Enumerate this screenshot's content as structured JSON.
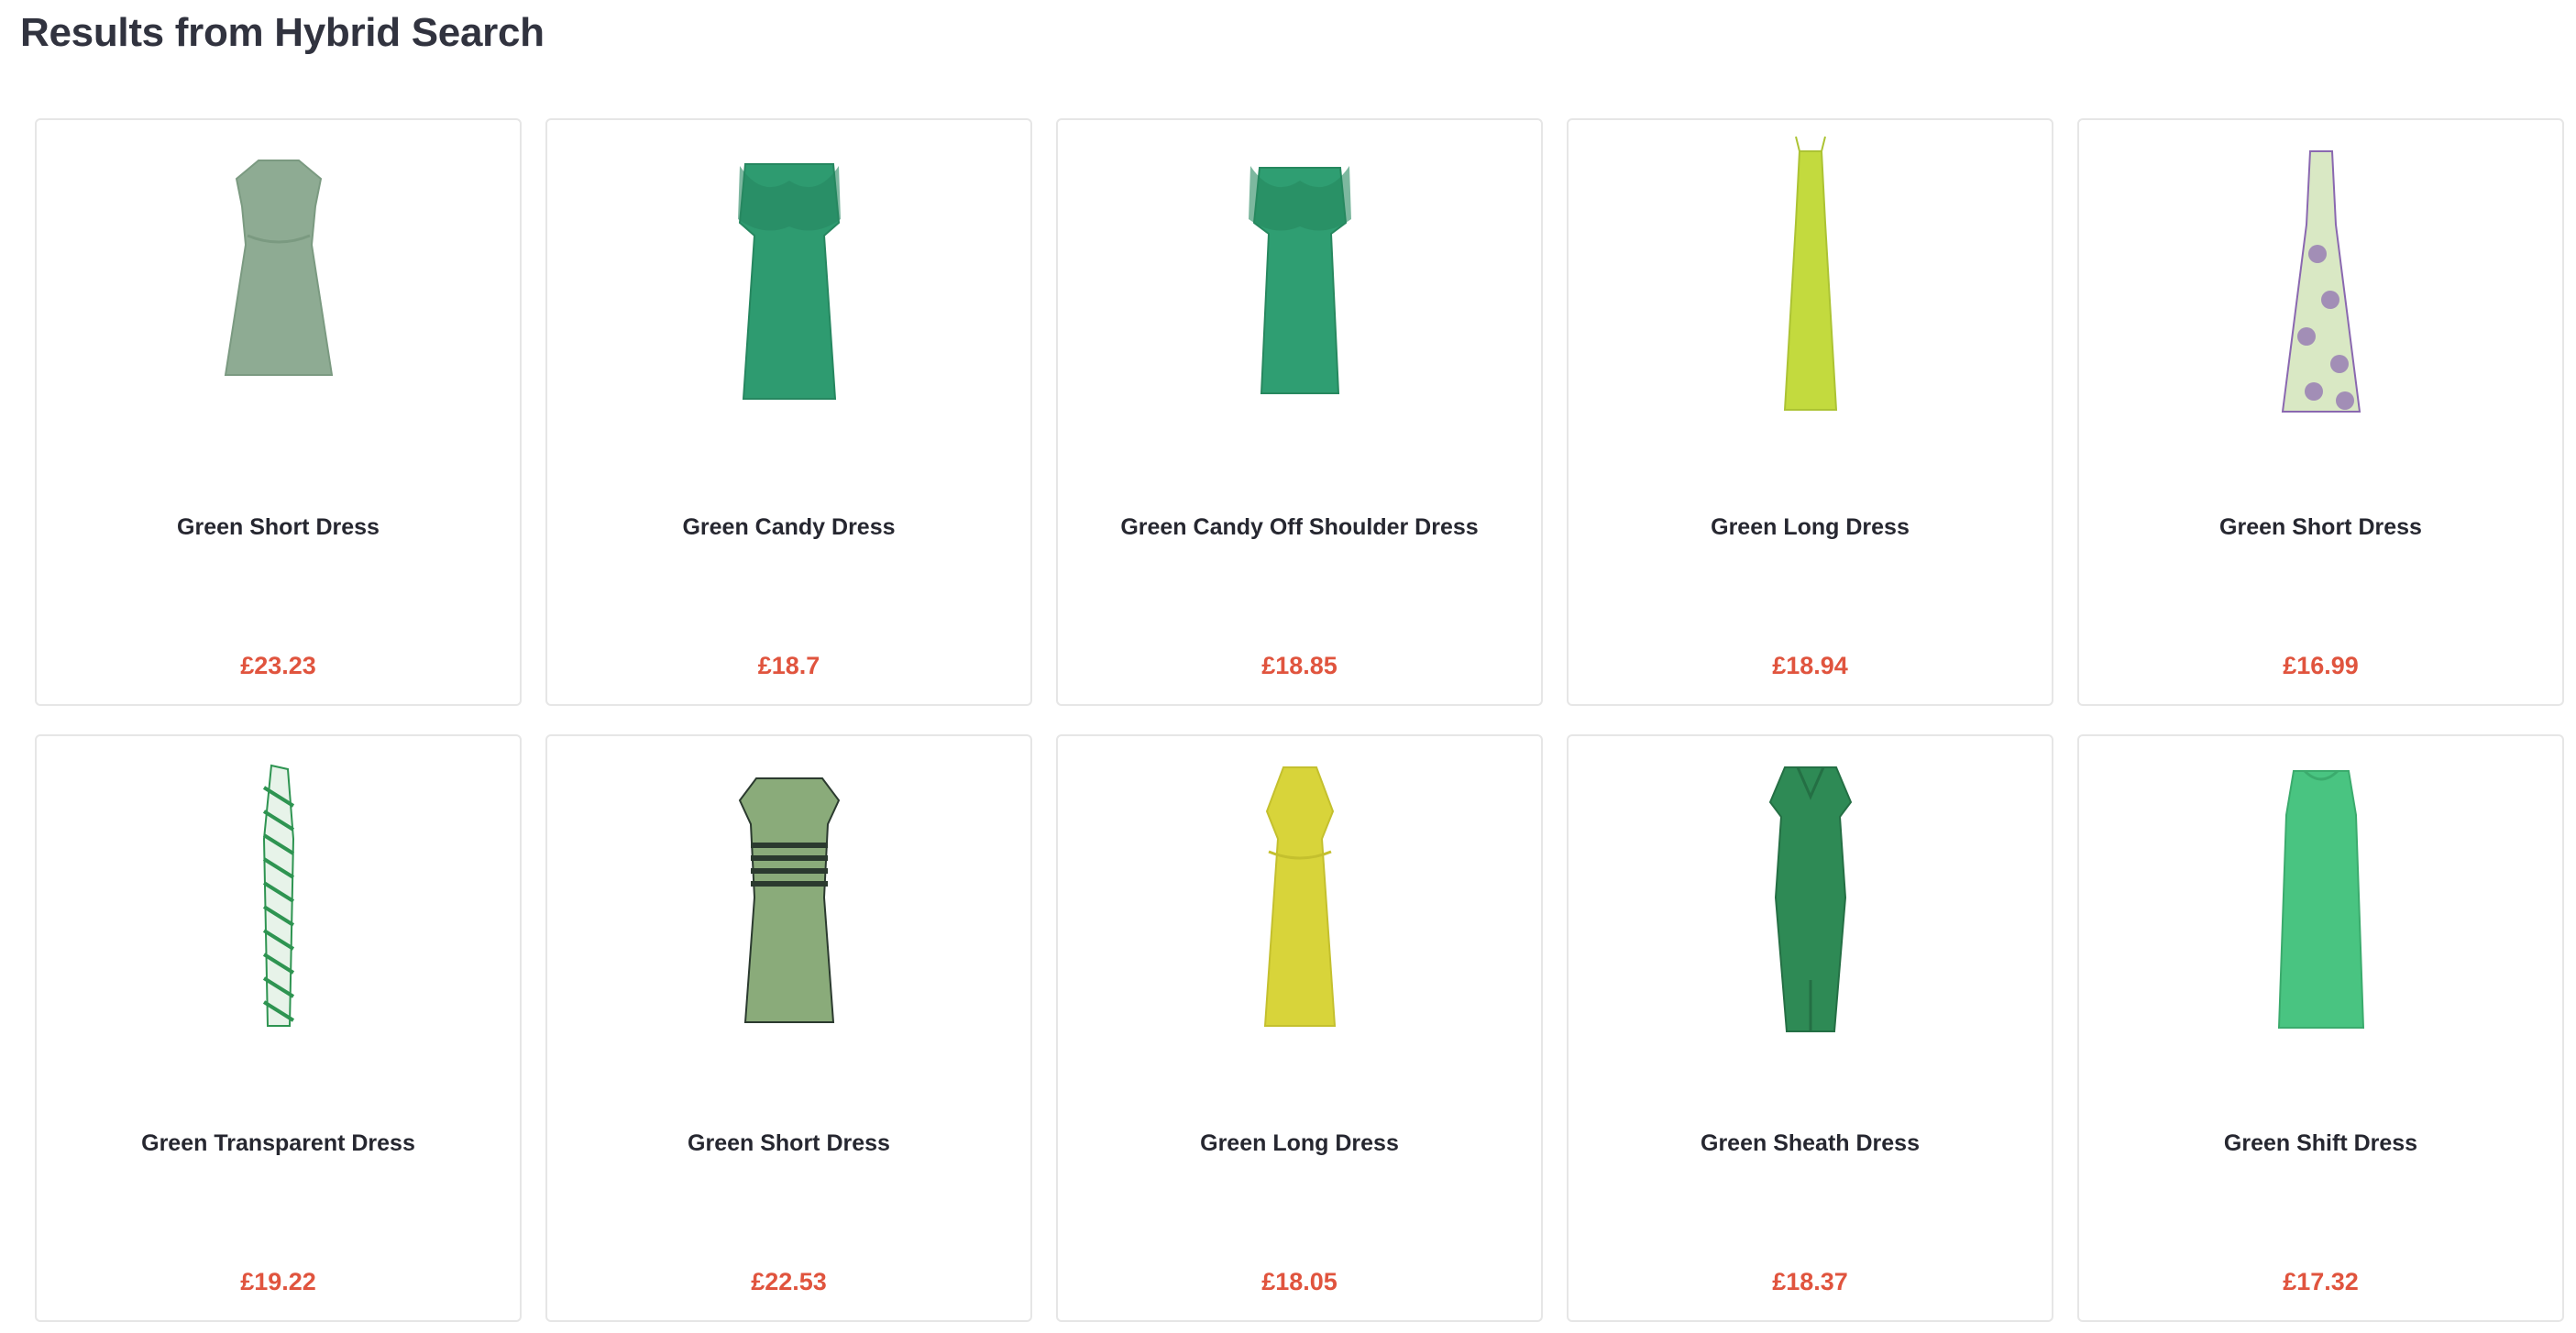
{
  "page": {
    "title": "Results from Hybrid Search"
  },
  "results": [
    {
      "name": "Green Short Dress",
      "price": "£23.23",
      "image": "dress-image",
      "style": "short-cap",
      "color": "#8eab93",
      "accent": "#7b9a81"
    },
    {
      "name": "Green Candy Dress",
      "price": "£18.7",
      "image": "dress-image",
      "style": "ruffle",
      "color": "#2e9b70",
      "accent": "#268760"
    },
    {
      "name": "Green Candy Off Shoulder Dress",
      "price": "£18.85",
      "image": "dress-image",
      "style": "ruffle-model",
      "color": "#2f9e72",
      "accent": "#27885f"
    },
    {
      "name": "Green Long Dress",
      "price": "£18.94",
      "image": "dress-image",
      "style": "long-strap",
      "color": "#c3da3e",
      "accent": "#acc333"
    },
    {
      "name": "Green Short Dress",
      "price": "£16.99",
      "image": "dress-image",
      "style": "long-floral",
      "color": "#d9e8c4",
      "accent": "#8a68b0"
    },
    {
      "name": "Green Transparent Dress",
      "price": "£19.22",
      "image": "dress-image",
      "style": "column-check",
      "color": "#e7f3e9",
      "accent": "#2e9451"
    },
    {
      "name": "Green Short Dress",
      "price": "£22.53",
      "image": "dress-image",
      "style": "short-belted",
      "color": "#8aab7a",
      "accent": "#2b3a2f"
    },
    {
      "name": "Green Long Dress",
      "price": "£18.05",
      "image": "dress-image",
      "style": "long-sheer",
      "color": "#d8d43a",
      "accent": "#c4c02e"
    },
    {
      "name": "Green Sheath Dress",
      "price": "£18.37",
      "image": "dress-image",
      "style": "sheath",
      "color": "#2e8a55",
      "accent": "#246f44"
    },
    {
      "name": "Green Shift Dress",
      "price": "£17.32",
      "image": "dress-image",
      "style": "shift",
      "color": "#49c481",
      "accent": "#3bab6d"
    }
  ]
}
